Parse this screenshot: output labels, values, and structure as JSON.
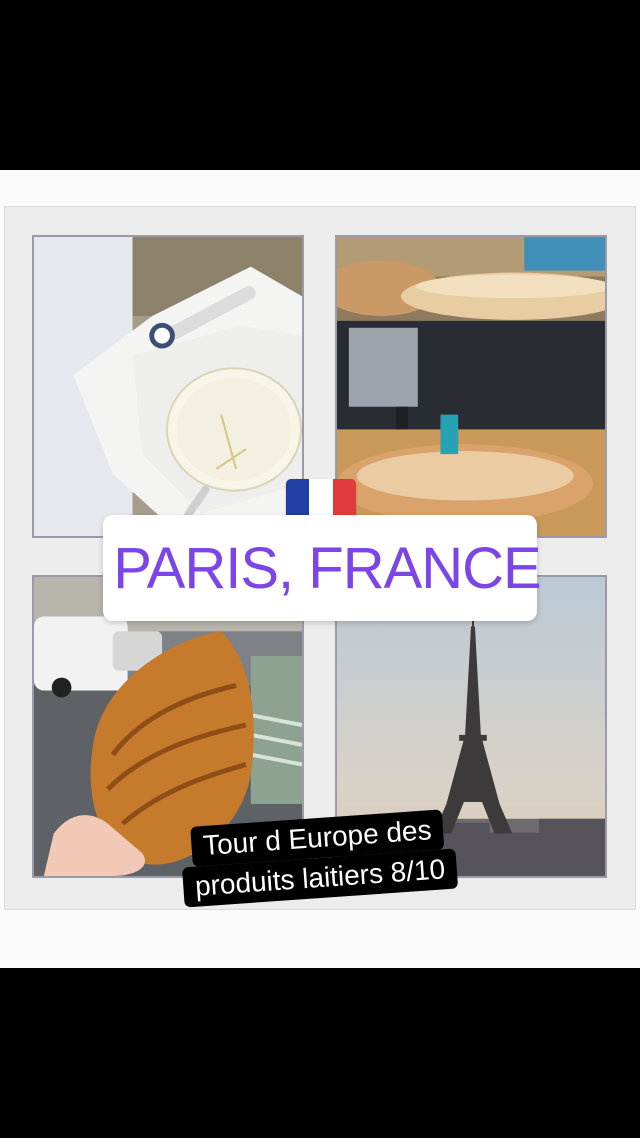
{
  "location": {
    "text": "PARIS, FRANCE",
    "icon": "map-pin-icon",
    "color": "#7b45e8"
  },
  "flag": {
    "icon": "france-flag-icon",
    "colors": [
      "#1f3fa4",
      "#ffffff",
      "#e03b3b"
    ]
  },
  "caption": {
    "line1": "Tour d Europe des",
    "line2": "produits laitiers 8/10"
  },
  "photos": [
    {
      "name": "camembert-cheese-photo"
    },
    {
      "name": "baguette-bread-photo"
    },
    {
      "name": "croissant-photo"
    },
    {
      "name": "eiffel-tower-photo"
    }
  ]
}
